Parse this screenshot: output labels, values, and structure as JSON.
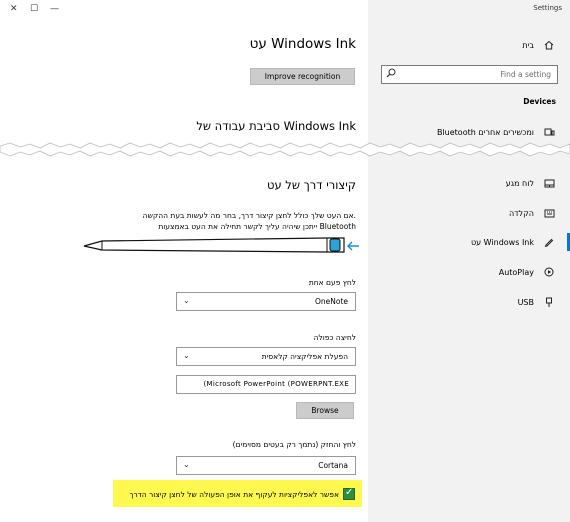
{
  "window": {
    "title": "Settings",
    "controls": {
      "close": "✕",
      "maximize": "☐",
      "minimize": "—"
    }
  },
  "sidebar": {
    "home": {
      "label": "בית",
      "icon": "home-icon"
    },
    "search": {
      "placeholder": "Find a setting",
      "icon": "search-icon"
    },
    "section": "Devices",
    "items": [
      {
        "label": "Bluetooth ומכשירים אחרים",
        "icon": "bluetooth-devices-icon"
      },
      {
        "label": "לוח מגע",
        "icon": "touchpad-icon"
      },
      {
        "label": "הקלדה",
        "icon": "keyboard-icon"
      },
      {
        "label": "עט Windows Ink",
        "icon": "pen-icon"
      },
      {
        "label": "AutoPlay",
        "icon": "autoplay-icon"
      },
      {
        "label": "USB",
        "icon": "usb-icon"
      }
    ],
    "accent": "#0078d7"
  },
  "main": {
    "title": "עט Windows Ink",
    "improve_button": "Improve recognition",
    "workspace_title": "סביבת עבודה של Windows Ink",
    "shortcut_title": "קיצורי דרך של עט",
    "shortcut_desc_1": "אם העט שלך כולל לחצן קיצור דרך, בחר מה לעשות בעת ההקשה.",
    "shortcut_desc_2": "ייתכן שיהיה עליך לקשר תחילה את העט באמצעות Bluetooth",
    "single_click_label": "לחץ פעם אחת",
    "single_click_value": "OneNote",
    "double_click_label": "לחיצה כפולה",
    "double_click_value": "הפעלת אפליקציה קלאסית",
    "app_path_value": "(Microsoft PowerPoint (POWERPNT.EXE",
    "browse_button": "Browse",
    "press_hold_label": "לחץ והחזק (נתמך רק בעטים מסוימים)",
    "press_hold_value": "Cortana",
    "allow_override_label": "אפשר לאפליקציות לעקוף את אופן הפעולה של לחצן קיצור הדרך",
    "allow_override_checked": true,
    "highlight_color": "#fff94f",
    "checkbox_color": "#2f8f3a",
    "checkmark": "✓",
    "chevron": "⌄"
  }
}
